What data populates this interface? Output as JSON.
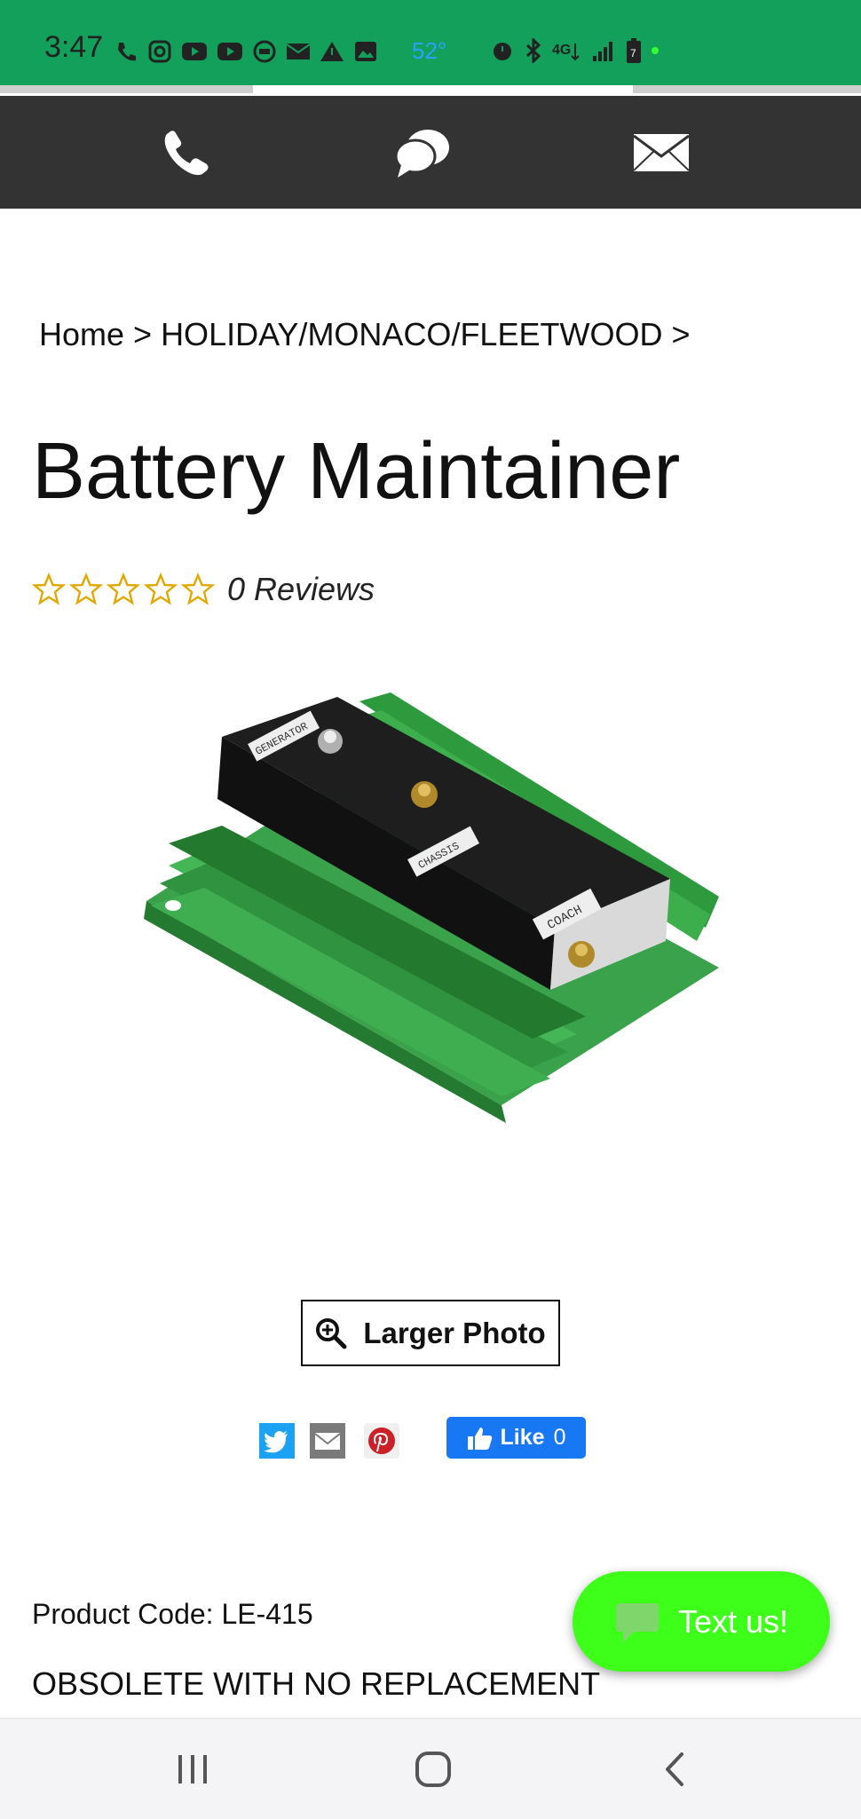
{
  "status_bar": {
    "time": "3:47",
    "temperature": "52°",
    "accent_color": "#12a05a",
    "left_icons": [
      "wifi-calling-icon",
      "instagram-icon",
      "youtube-icon",
      "youtube-icon",
      "kvno-icon",
      "mail-icon",
      "warning-icon",
      "image-icon"
    ],
    "right_icons": [
      "alarm-icon",
      "bluetooth-icon",
      "4g-icon",
      "signal-icon",
      "battery-icon",
      "green-dot-icon"
    ]
  },
  "page_load_progress": 0.68,
  "top_nav": {
    "background": "#333333",
    "buttons": [
      "phone-icon",
      "chat-bubbles-icon",
      "envelope-icon"
    ]
  },
  "breadcrumb": {
    "home": "Home",
    "separator": " > ",
    "category": "HOLIDAY/MONACO/FLEETWOOD",
    "trailing": " >"
  },
  "product": {
    "title": "Battery Maintainer",
    "rating_stars": 0,
    "rating_max": 5,
    "reviews_label": "0 Reviews",
    "image_labels": [
      "GENERATOR",
      "CHASSIS",
      "COACH"
    ],
    "larger_photo_label": "Larger Photo",
    "product_code": "Product Code: LE-415",
    "status": "OBSOLETE WITH NO REPLACEMENT"
  },
  "social": {
    "share_icons": [
      "twitter-icon",
      "email-icon",
      "pinterest-icon"
    ],
    "like_label": "Like",
    "like_count": "0"
  },
  "chat_widget": {
    "label": "Text us!",
    "color": "#3dff1a"
  },
  "system_nav": {
    "buttons": [
      "recent-apps-icon",
      "home-icon",
      "back-icon"
    ]
  }
}
